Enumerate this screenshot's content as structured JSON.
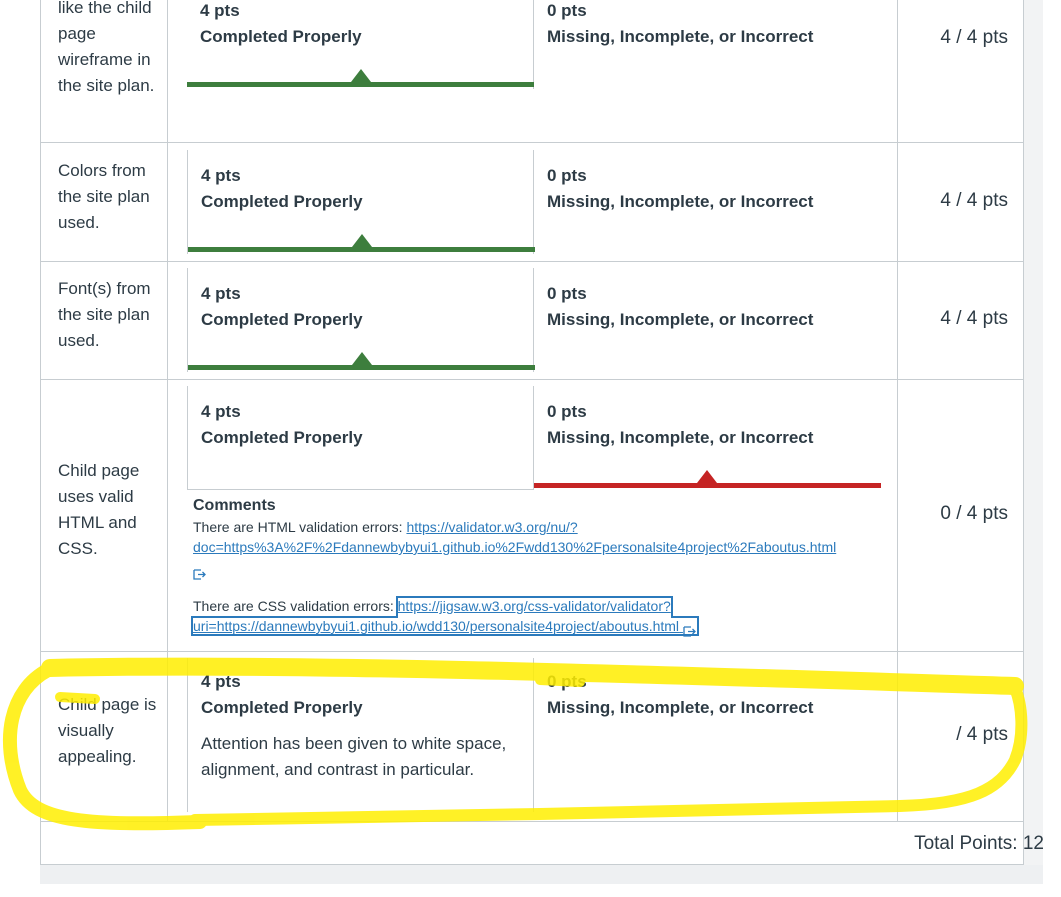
{
  "rows": [
    {
      "description": "like the child page wireframe in the site plan.",
      "ratings": [
        {
          "points": "4 pts",
          "label": "Completed Properly"
        },
        {
          "points": "0 pts",
          "label": "Missing, Incomplete, or Incorrect"
        }
      ],
      "selected_rating": 0,
      "score": "4 / 4 pts"
    },
    {
      "description": "Colors from the site plan used.",
      "ratings": [
        {
          "points": "4 pts",
          "label": "Completed Properly"
        },
        {
          "points": "0 pts",
          "label": "Missing, Incomplete, or Incorrect"
        }
      ],
      "selected_rating": 0,
      "score": "4 / 4 pts"
    },
    {
      "description": "Font(s) from the site plan used.",
      "ratings": [
        {
          "points": "4 pts",
          "label": "Completed Properly"
        },
        {
          "points": "0 pts",
          "label": "Missing, Incomplete, or Incorrect"
        }
      ],
      "selected_rating": 0,
      "score": "4 / 4 pts"
    },
    {
      "description": "Child page uses valid HTML and CSS.",
      "ratings": [
        {
          "points": "4 pts",
          "label": "Completed Properly"
        },
        {
          "points": "0 pts",
          "label": "Missing, Incomplete, or Incorrect"
        }
      ],
      "selected_rating": 1,
      "score": "0 / 4 pts",
      "comments": {
        "title": "Comments",
        "html_prefix": "There are HTML validation errors: ",
        "html_link": "https://validator.w3.org/nu/?doc=https%3A%2F%2Fdannewbybyui1.github.io%2Fwdd130%2Fpersonalsite4project%2Faboutus.html",
        "html_link_line1": "https://validator.w3.org/nu/?",
        "html_link_line2": "doc=https%3A%2F%2Fdannewbybyui1.github.io%2Fwdd130%2Fpersonalsite4project%2Faboutus.html",
        "css_prefix": "There are CSS validation errors: ",
        "css_link_line1": "https://jigsaw.w3.org/css-validator/validator?",
        "css_link_line2": "uri=https://dannewbybyui1.github.io/wdd130/personalsite4project/aboutus.html"
      }
    },
    {
      "description": "Child page is visually appealing.",
      "ratings": [
        {
          "points": "4 pts",
          "label": "Completed Properly",
          "long_description": "Attention has been given to white space, alignment, and contrast in particular."
        },
        {
          "points": "0 pts",
          "label": "Missing, Incomplete, or Incorrect"
        }
      ],
      "selected_rating": null,
      "score": " / 4 pts"
    }
  ],
  "total": "Total Points: 12",
  "colors": {
    "selected_green": "#3d7e3d",
    "selected_red": "#c52424",
    "link": "#2b7abc",
    "highlighter": "#ffee00"
  },
  "icons": {
    "external_link": "external-link-icon"
  }
}
